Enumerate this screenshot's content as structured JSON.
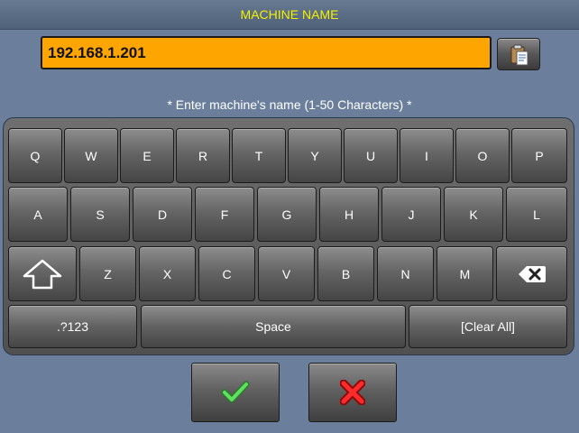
{
  "window": {
    "title": "MACHINE NAME"
  },
  "name_field": {
    "value": "192.168.1.201"
  },
  "hint": "* Enter machine's name (1-50 Characters) *",
  "keyboard": {
    "row1": [
      "Q",
      "W",
      "E",
      "R",
      "T",
      "Y",
      "U",
      "I",
      "O",
      "P"
    ],
    "row2": [
      "A",
      "S",
      "D",
      "F",
      "G",
      "H",
      "J",
      "K",
      "L"
    ],
    "row3": [
      "Z",
      "X",
      "C",
      "V",
      "B",
      "N",
      "M"
    ],
    "row4": {
      "symbols": ".?123",
      "space": "Space",
      "clear": "[Clear All]"
    }
  },
  "icons": {
    "paste": "clipboard-icon",
    "shift": "shift-arrow-icon",
    "backspace": "backspace-icon",
    "confirm": "checkmark-icon",
    "cancel": "cross-icon"
  },
  "colors": {
    "title_text": "#f3f000",
    "field_background": "#ffa500",
    "confirm": "#3cc83c",
    "cancel": "#e02020"
  }
}
